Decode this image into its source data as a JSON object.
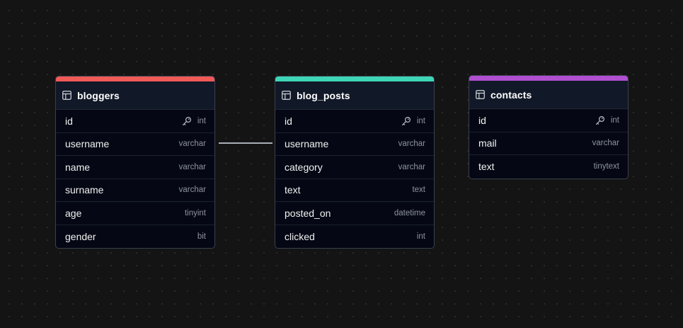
{
  "diagram": {
    "tables": [
      {
        "name": "bloggers",
        "accent_color": "#f05a57",
        "columns": [
          {
            "name": "id",
            "type": "int",
            "primary_key": true
          },
          {
            "name": "username",
            "type": "varchar",
            "primary_key": false
          },
          {
            "name": "name",
            "type": "varchar",
            "primary_key": false
          },
          {
            "name": "surname",
            "type": "varchar",
            "primary_key": false
          },
          {
            "name": "age",
            "type": "tinyint",
            "primary_key": false
          },
          {
            "name": "gender",
            "type": "bit",
            "primary_key": false
          }
        ]
      },
      {
        "name": "blog_posts",
        "accent_color": "#3dd6b6",
        "columns": [
          {
            "name": "id",
            "type": "int",
            "primary_key": true
          },
          {
            "name": "username",
            "type": "varchar",
            "primary_key": false
          },
          {
            "name": "category",
            "type": "varchar",
            "primary_key": false
          },
          {
            "name": "text",
            "type": "text",
            "primary_key": false
          },
          {
            "name": "posted_on",
            "type": "datetime",
            "primary_key": false
          },
          {
            "name": "clicked",
            "type": "int",
            "primary_key": false
          }
        ]
      },
      {
        "name": "contacts",
        "accent_color": "#b04fcf",
        "columns": [
          {
            "name": "id",
            "type": "int",
            "primary_key": true
          },
          {
            "name": "mail",
            "type": "varchar",
            "primary_key": false
          },
          {
            "name": "text",
            "type": "tinytext",
            "primary_key": false
          }
        ]
      }
    ],
    "relationships": [
      {
        "from": "bloggers.username",
        "to": "blog_posts.username"
      }
    ],
    "icons": {
      "table": "table-icon",
      "primary_key": "key-icon"
    }
  }
}
